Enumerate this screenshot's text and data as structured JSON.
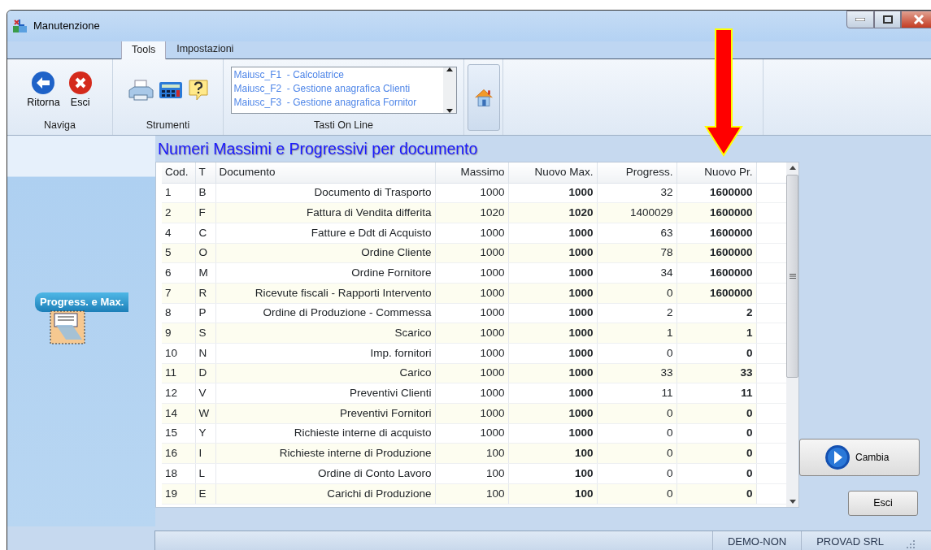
{
  "window": {
    "title": "Manutenzione"
  },
  "tabs": [
    {
      "label": "Tools",
      "selected": true
    },
    {
      "label": "Impostazioni",
      "selected": false
    }
  ],
  "ribbon": {
    "groups": [
      {
        "label": "Naviga",
        "kind": "nav",
        "buttons": [
          "Ritorna",
          "Esci"
        ]
      },
      {
        "label": "Strumenti",
        "kind": "tools"
      },
      {
        "label": "Tasti On Line",
        "kind": "list",
        "items": [
          "Maiusc_F1  - Calcolatrice",
          "Maiusc_F2  - Gestione anagrafica Clienti",
          "Maiusc_F3  - Gestione anagrafica Fornitor"
        ]
      },
      {
        "kind": "home"
      }
    ]
  },
  "sidebar": {
    "items": [
      {
        "label": "Progress.  e Max.",
        "selected": true
      }
    ]
  },
  "panel": {
    "title": "Numeri Massimi e Progressivi per documento"
  },
  "table": {
    "columns": [
      "Cod.",
      "T",
      "Documento",
      "Massimo",
      "Nuovo Max.",
      "Progress.",
      "Nuovo Pr."
    ],
    "rows": [
      [
        "1",
        "B",
        "Documento di Trasporto",
        "1000",
        "1000",
        "32",
        "1600000"
      ],
      [
        "2",
        "F",
        "Fattura di Vendita differita",
        "1020",
        "1020",
        "1400029",
        "1600000"
      ],
      [
        "4",
        "C",
        "Fatture e Ddt di Acquisto",
        "1000",
        "1000",
        "63",
        "1600000"
      ],
      [
        "5",
        "O",
        "Ordine Cliente",
        "1000",
        "1000",
        "78",
        "1600000"
      ],
      [
        "6",
        "M",
        "Ordine Fornitore",
        "1000",
        "1000",
        "34",
        "1600000"
      ],
      [
        "7",
        "R",
        "Ricevute fiscali - Rapporti Intervento",
        "1000",
        "1000",
        "0",
        "1600000"
      ],
      [
        "8",
        "P",
        "Ordine di Produzione - Commessa",
        "1000",
        "1000",
        "2",
        "2"
      ],
      [
        "9",
        "S",
        "Scarico",
        "1000",
        "1000",
        "1",
        "1"
      ],
      [
        "10",
        "N",
        "Imp. fornitori",
        "1000",
        "1000",
        "0",
        "0"
      ],
      [
        "11",
        "D",
        "Carico",
        "1000",
        "1000",
        "33",
        "33"
      ],
      [
        "12",
        "V",
        "Preventivi Clienti",
        "1000",
        "1000",
        "11",
        "11"
      ],
      [
        "14",
        "W",
        "Preventivi Fornitori",
        "1000",
        "1000",
        "0",
        "0"
      ],
      [
        "15",
        "Y",
        "Richieste interne di acquisto",
        "1000",
        "1000",
        "0",
        "0"
      ],
      [
        "16",
        "I",
        "Richieste interne di Produzione",
        "100",
        "100",
        "0",
        "0"
      ],
      [
        "18",
        "L",
        "Ordine di Conto Lavoro",
        "100",
        "100",
        "0",
        "0"
      ],
      [
        "19",
        "E",
        "Carichi di Produzione",
        "100",
        "100",
        "0",
        "0"
      ]
    ]
  },
  "buttons": [
    {
      "label": "Cambia",
      "kind": "primary"
    },
    {
      "label": "Esci",
      "kind": "plain"
    }
  ],
  "status_bar": [
    "DEMO-NON",
    "PROVAD SRL"
  ]
}
